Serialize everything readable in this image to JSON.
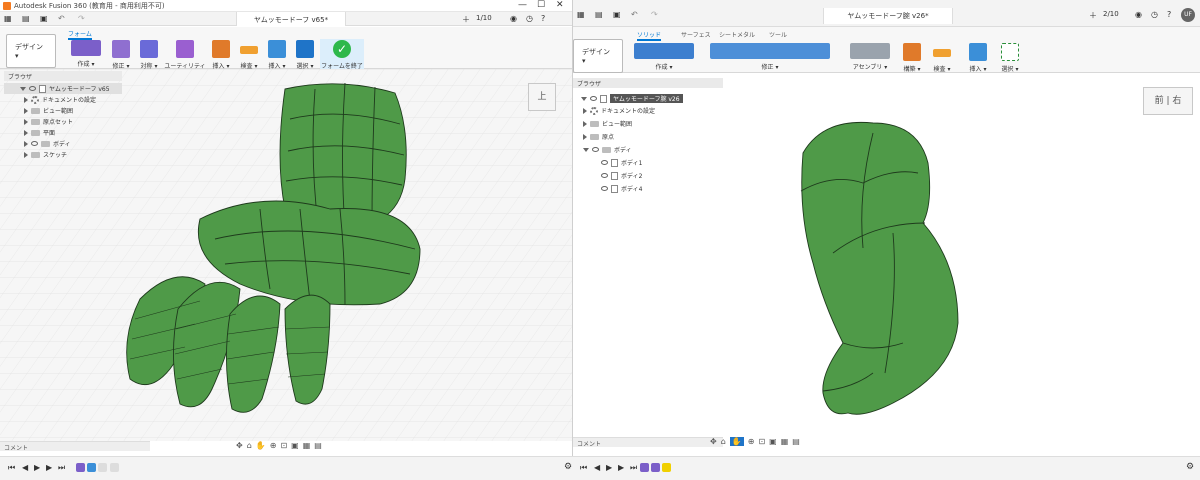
{
  "left": {
    "window_title": "Autodesk Fusion 360 (教育用 - 商用利用不可)",
    "window_controls": [
      "—",
      "☐",
      "✕"
    ],
    "doc_tab": "ヤムッモードーフ v65*",
    "tab_counter": "1/10",
    "workspace": "デザイン",
    "ribbon_tab": "フォーム",
    "groups": [
      "作成",
      "修正",
      "対称",
      "ユーティリティ",
      "挿入",
      "検査",
      "挿入",
      "選択",
      "フォームを終了"
    ],
    "browser_title": "ブラウザ",
    "browser_root": "ヤムッモードーフ v65",
    "browser_items": [
      "ドキュメントの設定",
      "ビュー範囲",
      "原点セット",
      "平面",
      "ボディ",
      "スケッチ"
    ],
    "viewcube_face": "上",
    "comment_label": "コメント"
  },
  "right": {
    "doc_tab": "ヤムッモードーフ腕 v26*",
    "tab_counter": "2/10",
    "user": "UF",
    "workspace": "デザイン",
    "ribbon_tabs": [
      "ソリッド",
      "サーフェス",
      "シートメタル",
      "ツール"
    ],
    "groups": [
      "作成",
      "修正",
      "アセンブリ",
      "構築",
      "検査",
      "挿入",
      "選択"
    ],
    "browser_title": "ブラウザ",
    "browser_root": "ヤムッモードーフ腕 v26",
    "browser_items": [
      "ドキュメントの設定",
      "ビュー範囲",
      "原点",
      "ボディ"
    ],
    "bodies": [
      "ボディ1",
      "ボディ2",
      "ボディ4"
    ],
    "viewcube_faces": [
      "前",
      "右"
    ],
    "comment_label": "コメント"
  },
  "colors": {
    "model_green": "#4f9a48",
    "accent": "#0078d4",
    "check": "#2eb84a"
  }
}
